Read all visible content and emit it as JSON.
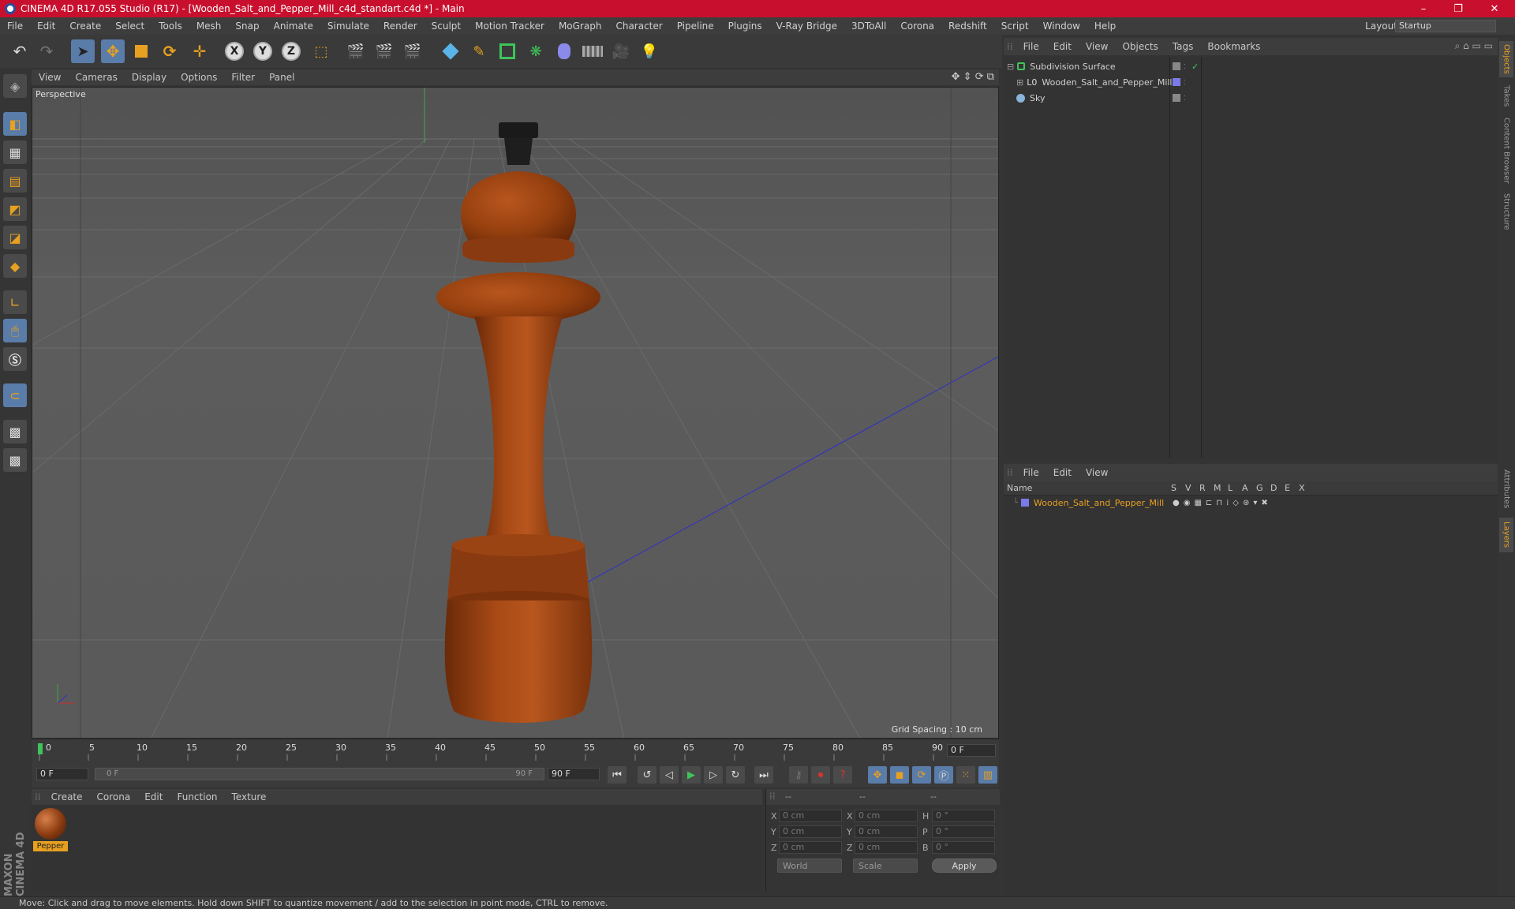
{
  "window": {
    "title": "CINEMA 4D R17.055 Studio (R17) - [Wooden_Salt_and_Pepper_Mill_c4d_standart.c4d *] - Main",
    "minimize": "–",
    "maximize": "❐",
    "close": "✕"
  },
  "menubar": {
    "items": [
      "File",
      "Edit",
      "Create",
      "Select",
      "Tools",
      "Mesh",
      "Snap",
      "Animate",
      "Simulate",
      "Render",
      "Sculpt",
      "Motion Tracker",
      "MoGraph",
      "Character",
      "Pipeline",
      "Plugins",
      "V-Ray Bridge",
      "3DToAll",
      "Corona",
      "Redshift",
      "Script",
      "Window",
      "Help"
    ],
    "layout_label": "Layout:",
    "layout_value": "Startup"
  },
  "toolbar": {
    "axis_x": "X",
    "axis_y": "Y",
    "axis_z": "Z"
  },
  "viewport": {
    "menu": [
      "View",
      "Cameras",
      "Display",
      "Options",
      "Filter",
      "Panel"
    ],
    "label": "Perspective",
    "grid_spacing": "Grid Spacing : 10 cm"
  },
  "timeline": {
    "ticks": [
      "0",
      "5",
      "10",
      "15",
      "20",
      "25",
      "30",
      "35",
      "40",
      "45",
      "50",
      "55",
      "60",
      "65",
      "70",
      "75",
      "80",
      "85",
      "90"
    ],
    "current_frame": "0 F",
    "start_field": "0 F",
    "range_start": "0 F",
    "range_end": "90 F",
    "end_field": "90 F"
  },
  "material_manager": {
    "menu": [
      "Create",
      "Corona",
      "Edit",
      "Function",
      "Texture"
    ],
    "materials": [
      {
        "name": "Pepper"
      }
    ]
  },
  "coordinates": {
    "header": [
      "--",
      "--",
      "--"
    ],
    "rows": [
      {
        "l1": "X",
        "v1": "0 cm",
        "l2": "X",
        "v2": "0 cm",
        "l3": "H",
        "v3": "0 °"
      },
      {
        "l1": "Y",
        "v1": "0 cm",
        "l2": "Y",
        "v2": "0 cm",
        "l3": "P",
        "v3": "0 °"
      },
      {
        "l1": "Z",
        "v1": "0 cm",
        "l2": "Z",
        "v2": "0 cm",
        "l3": "B",
        "v3": "0 °"
      }
    ],
    "mode1": "World",
    "mode2": "Scale",
    "apply": "Apply"
  },
  "object_manager": {
    "menu": [
      "File",
      "Edit",
      "View",
      "Objects",
      "Tags",
      "Bookmarks"
    ],
    "objects": [
      {
        "name": "Subdivision Surface"
      },
      {
        "name": "Wooden_Salt_and_Pepper_Mill"
      },
      {
        "name": "Sky"
      }
    ]
  },
  "layer_manager": {
    "menu": [
      "File",
      "Edit",
      "View"
    ],
    "columns": [
      "Name",
      "S",
      "V",
      "R",
      "M",
      "L",
      "A",
      "G",
      "D",
      "E",
      "X"
    ],
    "layers": [
      {
        "name": "Wooden_Salt_and_Pepper_Mill"
      }
    ]
  },
  "right_tabs": [
    "Objects",
    "Takes",
    "Content Browser",
    "Structure",
    "Attributes",
    "Layers"
  ],
  "status": "Move: Click and drag to move elements. Hold down SHIFT to quantize movement / add to the selection in point mode, CTRL to remove.",
  "brand": "MAXON CINEMA 4D",
  "colors": {
    "accent": "#e8a020",
    "selection": "#5a7ca8",
    "titlebar": "#c8102e"
  }
}
